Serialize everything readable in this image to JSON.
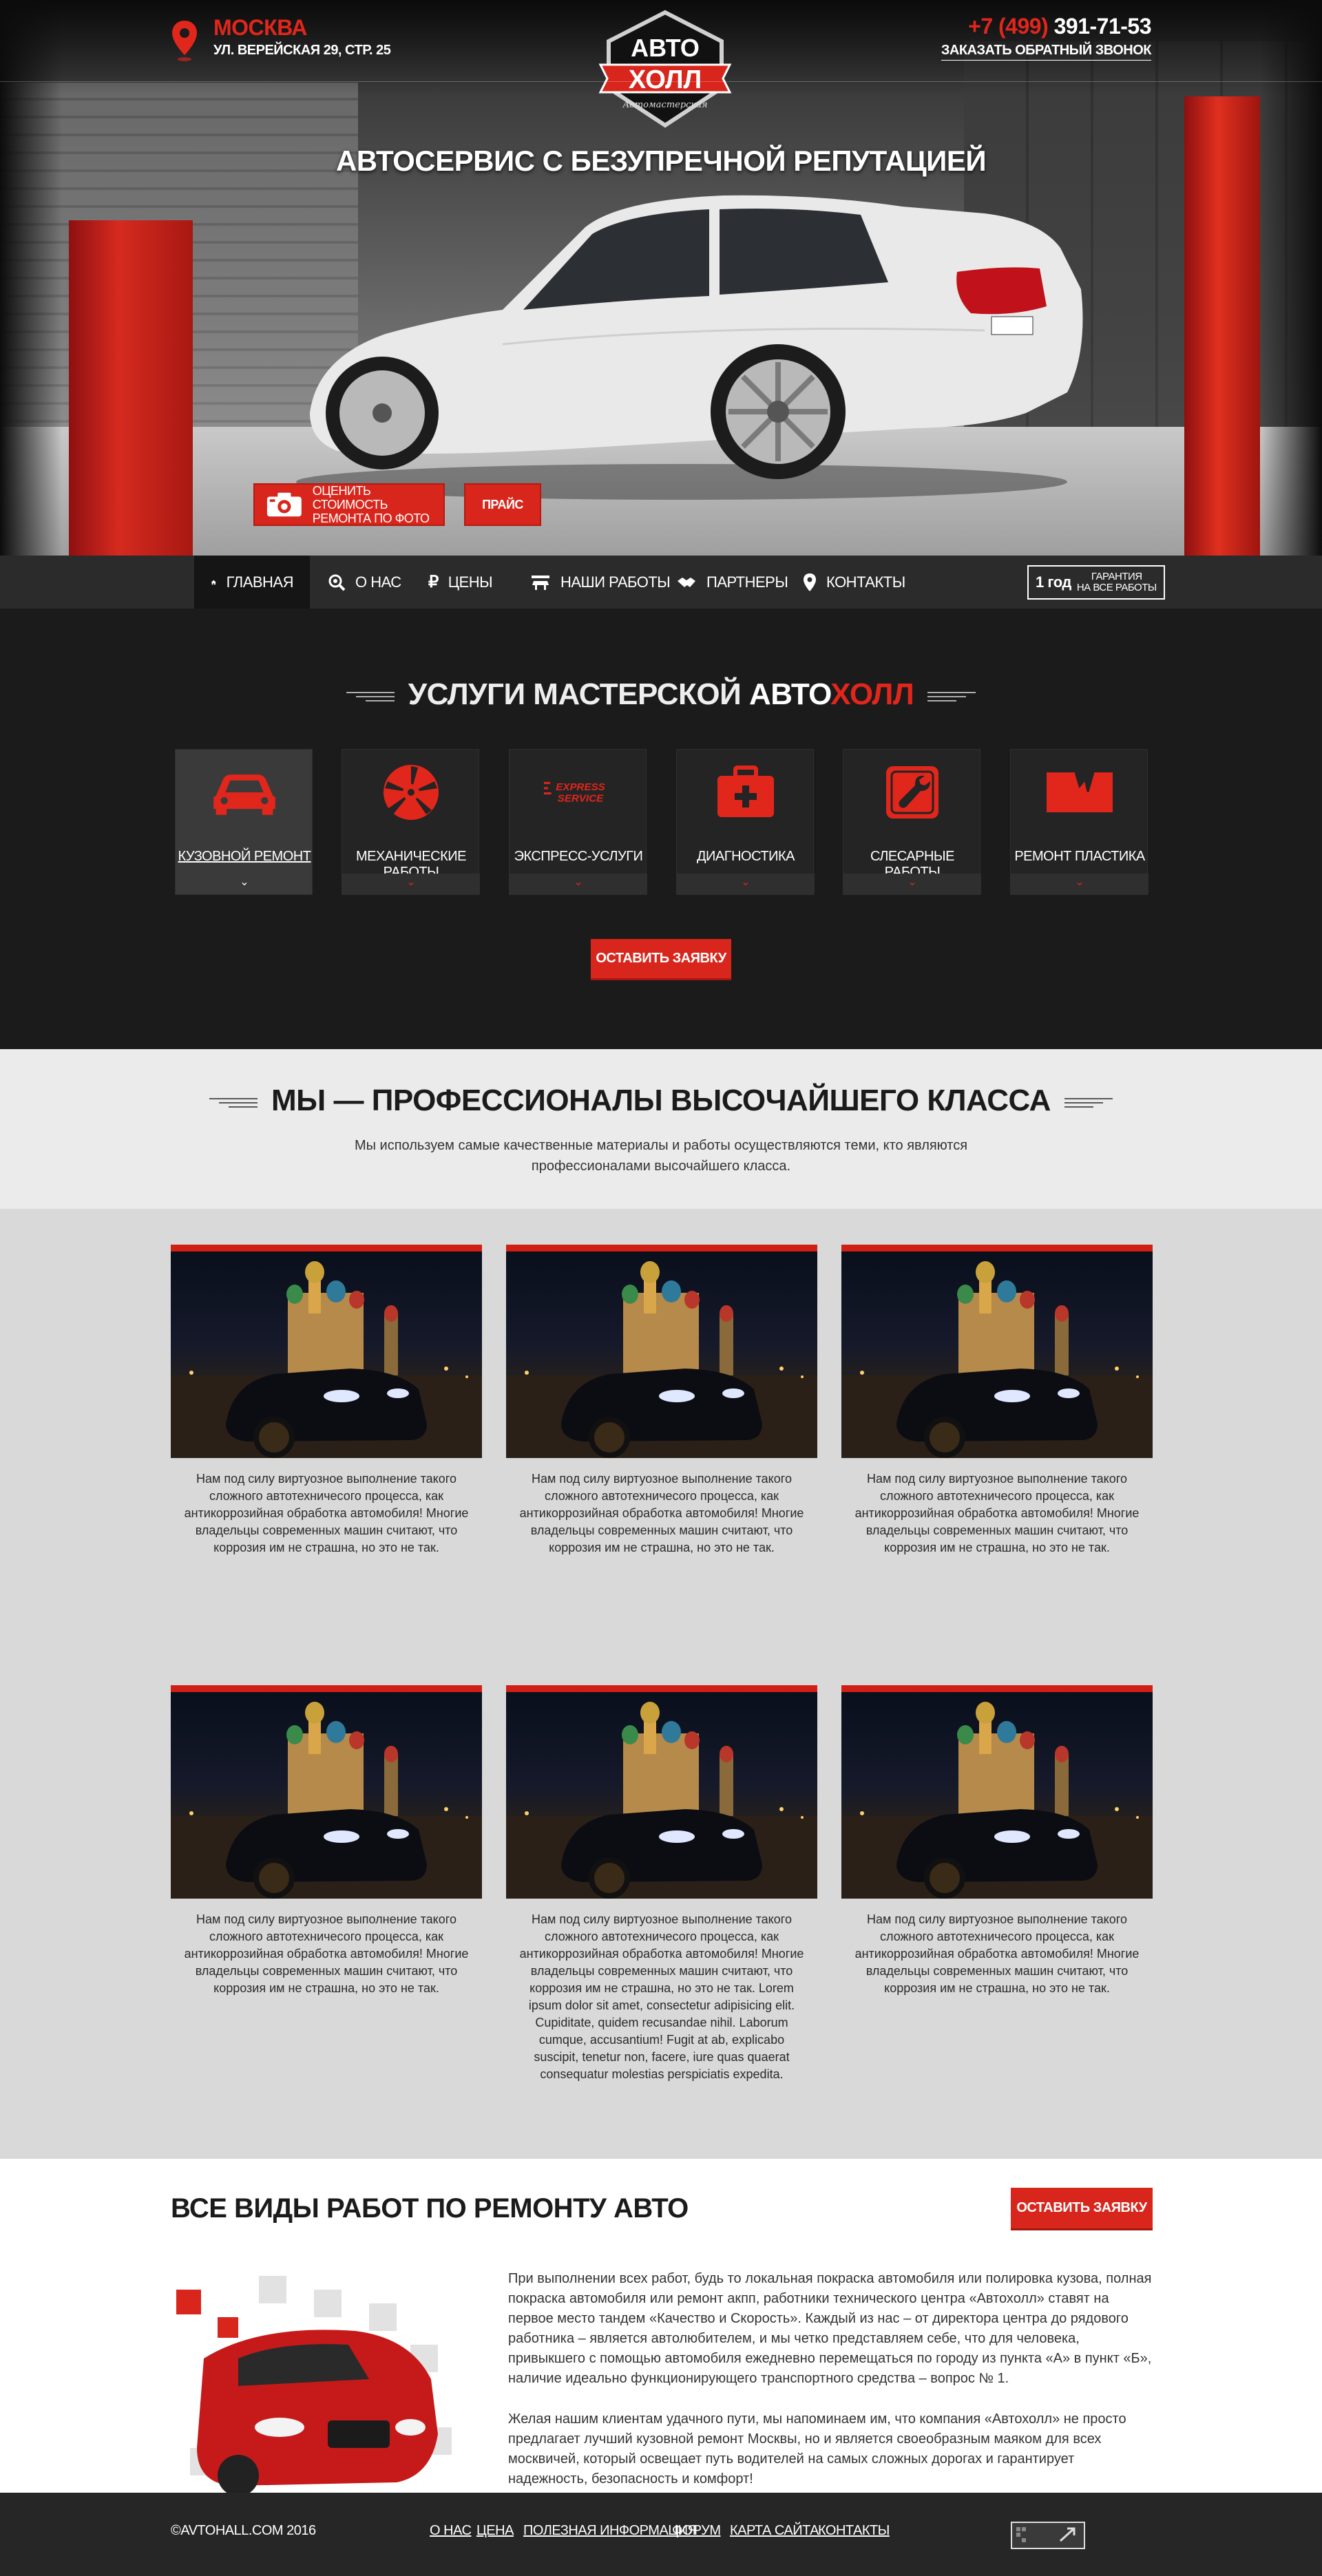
{
  "header": {
    "city": "МОСКВА",
    "address": "УЛ. ВЕРЕЙСКАЯ 29, СТР. 25",
    "logo_top": "АВТО",
    "logo_main": "ХОЛЛ",
    "logo_sub": "Автомастерская",
    "phone_code": "+7 (499)",
    "phone_number": "391-71-53",
    "callback": "ЗАКАЗАТЬ ОБРАТНЫЙ ЗВОНОК"
  },
  "hero": {
    "title": "АВТОСЕРВИС С БЕЗУПРЕЧНОЙ РЕПУТАЦИЕЙ",
    "estimate_line1": "ОЦЕНИТЬ СТОИМОСТЬ",
    "estimate_line2": "РЕМОНТА ПО ФОТО",
    "price": "ПРАЙС"
  },
  "nav": {
    "items": [
      {
        "label": "ГЛАВНАЯ",
        "icon": "home-icon"
      },
      {
        "label": "О НАС",
        "icon": "search-gear-icon"
      },
      {
        "label": "ЦЕНЫ",
        "icon": "ruble-icon"
      },
      {
        "label": "НАШИ РАБОТЫ",
        "icon": "car-lift-icon"
      },
      {
        "label": "ПАРТНЕРЫ",
        "icon": "handshake-icon"
      },
      {
        "label": "КОНТАКТЫ",
        "icon": "location-pin-icon"
      }
    ],
    "guarantee_big": "1 год",
    "guarantee_line1": "ГАРАНТИЯ",
    "guarantee_line2": "НА ВСЕ РАБОТЫ"
  },
  "services": {
    "title_plain": "УСЛУГИ МАСТЕРСКОЙ ",
    "title_bold": "АВТО",
    "title_accent": "ХОЛЛ",
    "items": [
      {
        "label": "КУЗОВНОЙ РЕМОНТ",
        "icon": "car-body-icon"
      },
      {
        "label": "МЕХАНИЧЕСКИЕ РАБОТЫ",
        "icon": "gear-wheel-icon"
      },
      {
        "label": "ЭКСПРЕСС-УСЛУГИ",
        "icon": "express-service-icon",
        "badge1": "EXPRESS",
        "badge2": "SERVICE"
      },
      {
        "label": "ДИАГНОСТИКА",
        "icon": "first-aid-kit-icon"
      },
      {
        "label": "СЛЕСАРНЫЕ РАБОТЫ",
        "icon": "wrench-icon"
      },
      {
        "label": "РЕМОНТ ПЛАСТИКА",
        "icon": "broken-panel-icon"
      }
    ],
    "order_button": "ОСТАВИТЬ ЗАЯВКУ"
  },
  "pro": {
    "title": "МЫ — ПРОФЕССИОНАЛЫ ВЫСОЧАЙШЕГО КЛАССА",
    "text": "Мы используем самые качественные материалы и работы осуществляются теми, кто являются профессионалами высочайшего класса."
  },
  "gallery": {
    "items": [
      {
        "text": "Нам под силу виртуозное выполнение такого сложного автотехничесого процесса, как антикоррозийная обработка автомобиля! Многие владельцы современных машин считают, что коррозия им не страшна, но это не так."
      },
      {
        "text": "Нам под силу виртуозное выполнение такого сложного автотехничесого процесса, как антикоррозийная обработка автомобиля! Многие владельцы современных машин считают, что коррозия им не страшна, но это не так."
      },
      {
        "text": "Нам под силу виртуозное выполнение такого сложного автотехничесого процесса, как антикоррозийная обработка автомобиля! Многие владельцы современных машин считают, что коррозия им не страшна, но это не так."
      },
      {
        "text": "Нам под силу виртуозное выполнение такого сложного автотехничесого процесса, как антикоррозийная обработка автомобиля! Многие владельцы современных машин считают, что коррозия им не страшна, но это не так."
      },
      {
        "text": "Нам под силу виртуозное выполнение такого сложного автотехничесого процесса, как антикоррозийная обработка автомобиля! Многие владельцы современных машин считают, что коррозия им не страшна, но это не так. Lorem ipsum dolor sit amet, consectetur adipisicing elit. Cupiditate, quidem recusandae nihil. Laborum cumque, accusantium! Fugit at ab, explicabo suscipit, tenetur non, facere, iure quas quaerat consequatur molestias perspiciatis expedita."
      },
      {
        "text": "Нам под силу виртуозное выполнение такого сложного автотехничесого процесса, как антикоррозийная обработка автомобиля! Многие владельцы современных машин считают, что коррозия им не страшна, но это не так."
      }
    ]
  },
  "works": {
    "title": "ВСЕ ВИДЫ РАБОТ ПО РЕМОНТУ АВТО",
    "order_button": "ОСТАВИТЬ ЗАЯВКУ",
    "p1": "При выполнении всех работ, будь то локальная покраска автомобиля или полировка кузова, полная покраска автомобиля или ремонт акпп, работники технического центра «Автохолл» ставят на первое место тандем «Качество и Скорость». Каждый из нас – от директора центра до рядового работника – является автолюбителем, и мы четко представляем себе, что для человека, привыкшего с помощью автомобиля ежедневно перемещаться по городу из пункта «А» в пункт «Б», наличие идеально функционирующего транспортного средства – вопрос № 1.",
    "p2": "Желая нашим клиентам удачного пути, мы напоминаем им, что компания «Автохолл» не просто предлагает лучший кузовной ремонт Москвы, но и является своеобразным маяком для всех москвичей, который освещает путь водителей на самых сложных дорогах и гарантирует надежность, безопасность и комфорт!"
  },
  "footer": {
    "copyright": "©AVTOHALL.COM 2016",
    "links": [
      "О НАС",
      "ЦЕНА",
      "ПОЛЕЗНАЯ ИНФОРМАЦИЯ",
      "ФОРУМ",
      "КАРТА САЙТА",
      "КОНТАКТЫ"
    ]
  },
  "colors": {
    "accent": "#d8261c",
    "dark": "#1b1b1b",
    "nav": "#2b2b2b",
    "light": "#ebebeb"
  }
}
